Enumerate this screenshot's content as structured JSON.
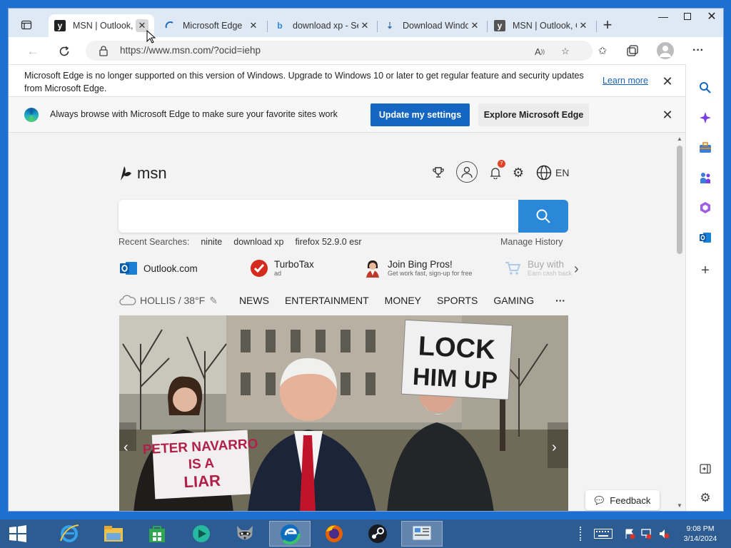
{
  "tabs": [
    {
      "title": "MSN | Outlook, Office",
      "active": true,
      "favicon": "msn-icon"
    },
    {
      "title": "Microsoft Edge",
      "active": false,
      "favicon": "loading-icon"
    },
    {
      "title": "download xp - Search",
      "active": false,
      "favicon": "bing-icon"
    },
    {
      "title": "Download Windows",
      "active": false,
      "favicon": "download-icon"
    },
    {
      "title": "MSN | Outlook, Office",
      "active": false,
      "favicon": "msn-icon"
    }
  ],
  "address_bar": {
    "url": "https://www.msn.com/?ocid=iehp"
  },
  "unsupported_bar": {
    "message": "Microsoft Edge is no longer supported on this version of Windows. Upgrade to Windows 10 or later to get regular feature and security updates from Microsoft Edge.",
    "link": "Learn more"
  },
  "default_bar": {
    "message": "Always browse with Microsoft Edge to make sure your favorite sites work",
    "primary_button": "Update my settings",
    "secondary_button": "Explore Microsoft Edge"
  },
  "msn": {
    "logo_text": "msn",
    "notification_count": "7",
    "language": "EN",
    "recent_label": "Recent Searches:",
    "recent_searches": [
      "ninite",
      "download xp",
      "firefox 52.9.0 esr"
    ],
    "manage_history": "Manage History",
    "quick_links": [
      {
        "title": "Outlook.com",
        "subtitle": ""
      },
      {
        "title": "TurboTax",
        "subtitle": "ad"
      },
      {
        "title": "Join Bing Pros!",
        "subtitle": "Get work fast, sign-up for free"
      },
      {
        "title": "Buy with",
        "subtitle": "Earn cash back"
      }
    ],
    "weather": "HOLLIS / 38°F",
    "nav_links": [
      "NEWS",
      "ENTERTAINMENT",
      "MONEY",
      "SPORTS",
      "GAMING"
    ],
    "more": "···",
    "hero": {
      "sign_left": [
        "PETER NAVARRO",
        "IS A",
        "LIAR"
      ],
      "sign_right": [
        "LOCK",
        "HIM UP"
      ]
    },
    "feedback": "Feedback"
  },
  "taskbar": {
    "apps": [
      "internet-explorer",
      "file-explorer",
      "store",
      "media-player",
      "raccoon-app",
      "edge",
      "firefox",
      "steam",
      "control-panel"
    ],
    "clock_time": "9:08 PM",
    "clock_date": "3/14/2024"
  },
  "colors": {
    "accent": "#1466c2",
    "search": "#2b88d8",
    "taskbar": "#2d5c92"
  }
}
